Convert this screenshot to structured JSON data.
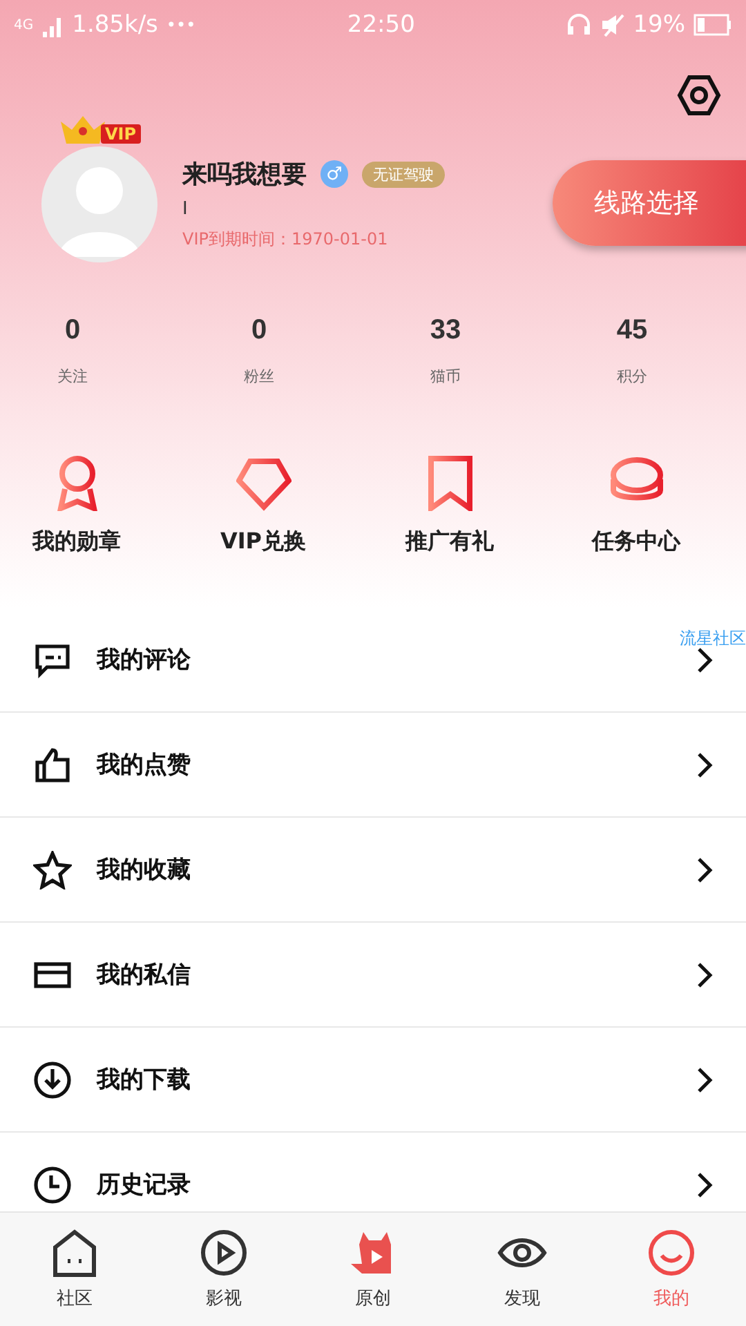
{
  "status_bar": {
    "network": "4G",
    "speed": "1.85k/s",
    "more": "•••",
    "time": "22:50",
    "battery_text": "19%"
  },
  "profile": {
    "vip_badge": "VIP",
    "name": "来吗我想要",
    "gender": "♂",
    "tag": "无证驾驶",
    "bio": "I",
    "vip_expiry": "VIP到期时间：1970-01-01",
    "route_button": "线路选择"
  },
  "stats": [
    {
      "value": "0",
      "label": "关注"
    },
    {
      "value": "0",
      "label": "粉丝"
    },
    {
      "value": "33",
      "label": "猫币"
    },
    {
      "value": "45",
      "label": "积分"
    }
  ],
  "shortcuts": [
    {
      "label": "我的勋章"
    },
    {
      "label": "VIP兑换"
    },
    {
      "label": "推广有礼"
    },
    {
      "label": "任务中心"
    }
  ],
  "menu": [
    {
      "label": "我的评论"
    },
    {
      "label": "我的点赞"
    },
    {
      "label": "我的收藏"
    },
    {
      "label": "我的私信"
    },
    {
      "label": "我的下载"
    },
    {
      "label": "历史记录"
    }
  ],
  "overlay_link": "流星社区",
  "tabs": [
    {
      "label": "社区",
      "selected": false
    },
    {
      "label": "影视",
      "selected": false
    },
    {
      "label": "原创",
      "selected": false
    },
    {
      "label": "发现",
      "selected": false
    },
    {
      "label": "我的",
      "selected": true
    }
  ]
}
